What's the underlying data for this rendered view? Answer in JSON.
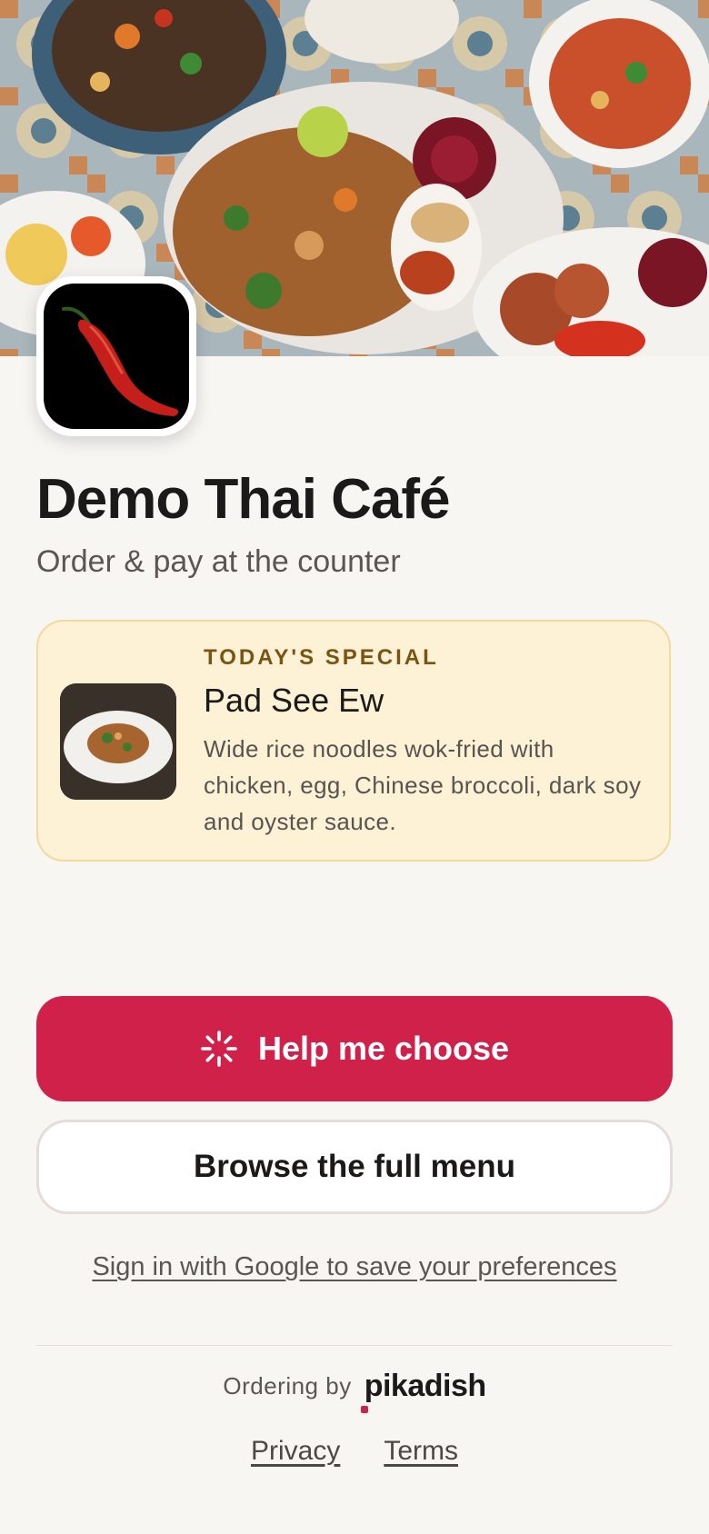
{
  "restaurant": {
    "name": "Demo Thai Café",
    "subtitle": "Order & pay at the counter"
  },
  "special": {
    "tag": "TODAY'S SPECIAL",
    "name": "Pad See Ew",
    "description": "Wide rice noodles wok-fried with chicken, egg, Chinese broccoli, dark soy and oyster sauce."
  },
  "actions": {
    "help_label": "Help me choose",
    "browse_label": "Browse the full menu",
    "google_label": "Sign in with Google to save your preferences"
  },
  "footer": {
    "ordering_label": "Ordering by",
    "brand": "pikadish",
    "privacy": "Privacy",
    "terms": "Terms"
  },
  "colors": {
    "accent": "#cf214a",
    "special_bg": "#fdf1d6",
    "special_border": "#f3d99b",
    "page_bg": "#f8f6f3"
  },
  "icons": {
    "help": "sparkle-spinner-icon",
    "logo": "chili-pepper-icon"
  }
}
